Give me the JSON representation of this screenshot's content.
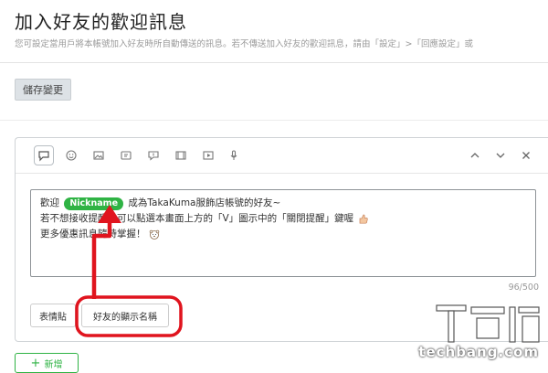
{
  "page": {
    "title": "加入好友的歡迎訊息",
    "description": "您可設定當用戶將本帳號加入好友時所自動傳送的訊息。若不傳送加入好友的歡迎訊息，請由「設定」>「回應設定」或"
  },
  "actions": {
    "save_label": "儲存變更",
    "add_label": "新增"
  },
  "toolbar": {
    "tools": [
      "text-icon",
      "sticker-icon",
      "image-icon",
      "coupon-icon",
      "rich-message-icon",
      "rich-video-icon",
      "video-icon",
      "audio-icon"
    ],
    "controls": [
      "chevron-up-icon",
      "chevron-down-icon",
      "close-icon"
    ]
  },
  "message": {
    "line1_prefix": "歡迎",
    "nickname_tag": "Nickname",
    "line1_suffix": "成為TakaKuma服飾店帳號的好友~",
    "line2": "若不想接收提醒，可以點選本畫面上方的「V」圖示中的「關閉提醒」鍵喔",
    "line3": "更多優惠訊息隨時掌握！"
  },
  "counter": "96/500",
  "insert_buttons": {
    "sticker": "表情貼",
    "nickname": "好友的顯示名稱"
  },
  "annotation": {
    "arrow_color": "#e0141e",
    "highlight_color": "#e0141e"
  },
  "accent_color": "#2fb344",
  "watermark": {
    "text": "techbang.com"
  }
}
